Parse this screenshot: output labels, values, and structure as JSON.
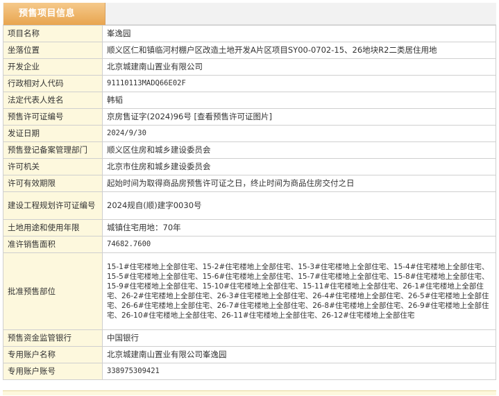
{
  "section": {
    "tab_label": "预售项目信息"
  },
  "rows": [
    {
      "label": "项目名称",
      "value": "峯逸园"
    },
    {
      "label": "坐落位置",
      "value": "顺义区仁和镇临河村棚户区改造土地开发A片区项目SY00-0702-15、26地块R2二类居住用地"
    },
    {
      "label": "开发企业",
      "value": "北京城建南山置业有限公司"
    },
    {
      "label": "行政相对人代码",
      "value": "91110113MADQ66E02F"
    },
    {
      "label": "法定代表人姓名",
      "value": "韩韬"
    },
    {
      "label": "预售许可证编号",
      "value": "京房售证字(2024)96号",
      "link": "[查看预售许可证图片]"
    },
    {
      "label": "发证日期",
      "value": "2024/9/30"
    },
    {
      "label": "预售登记备案管理部门",
      "value": "顺义区住房和城乡建设委员会"
    },
    {
      "label": "许可机关",
      "value": "北京市住房和城乡建设委员会"
    },
    {
      "label": "许可有效期限",
      "value": "起始时间为取得商品房预售许可证之日，终止时间为商品住房交付之日"
    },
    {
      "label": "建设工程规划许可证编号",
      "value": "2024规自(顺)建字0030号"
    },
    {
      "label": "土地用途和使用年限",
      "value": "城镇住宅用地：70年"
    },
    {
      "label": "准许销售面积",
      "value": "74682.7600"
    },
    {
      "label": "批准预售部位",
      "value": "15-1#住宅楼地上全部住宅、15-2#住宅楼地上全部住宅、15-3#住宅楼地上全部住宅、15-4#住宅楼地上全部住宅、15-5#住宅楼地上全部住宅、15-6#住宅楼地上全部住宅、15-7#住宅楼地上全部住宅、15-8#住宅楼地上全部住宅、15-9#住宅楼地上全部住宅、15-10#住宅楼地上全部住宅、15-11#住宅楼地上全部住宅、26-1#住宅楼地上全部住宅、26-2#住宅楼地上全部住宅、26-3#住宅楼地上全部住宅、26-4#住宅楼地上全部住宅、26-5#住宅楼地上全部住宅、26-6#住宅楼地上全部住宅、26-7#住宅楼地上全部住宅、26-8#住宅楼地上全部住宅、26-9#住宅楼地上全部住宅、26-10#住宅楼地上全部住宅、26-11#住宅楼地上全部住宅、26-12#住宅楼地上全部住宅"
    },
    {
      "label": "预售资金监管银行",
      "value": "中国银行"
    },
    {
      "label": "专用账户名称",
      "value": "北京城建南山置业有限公司峯逸园"
    },
    {
      "label": "专用账户账号",
      "value": "338975309421"
    }
  ]
}
